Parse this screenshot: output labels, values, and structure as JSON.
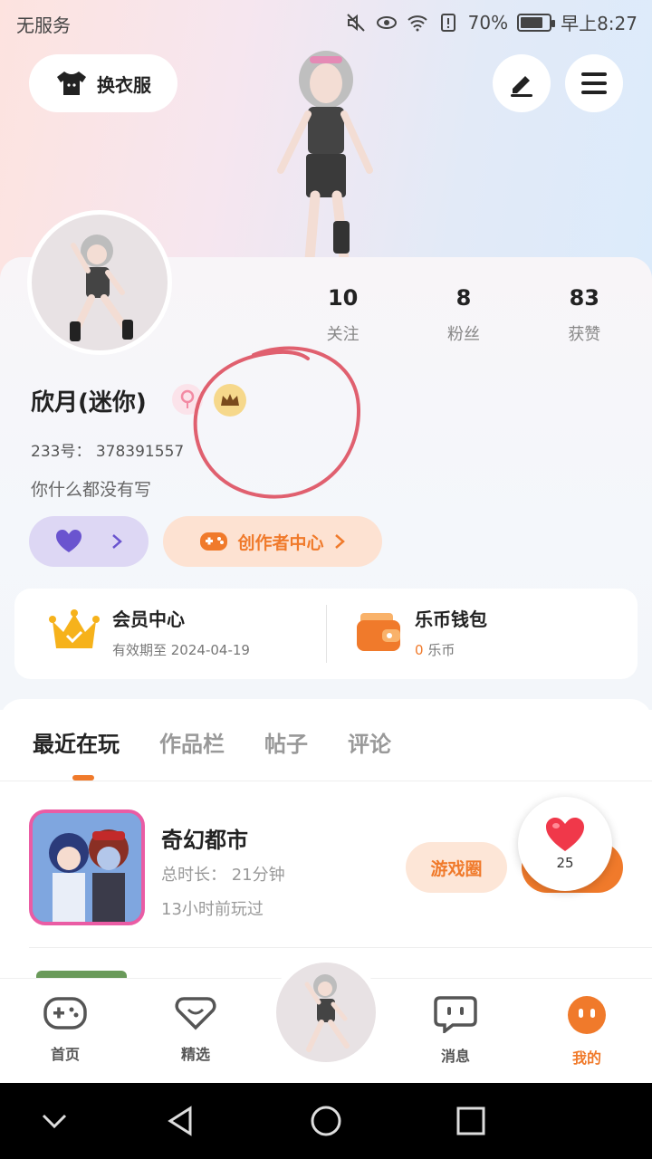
{
  "status_bar": {
    "carrier": "无服务",
    "battery": "70%",
    "time": "早上8:27"
  },
  "header": {
    "outfit_label": "换衣服"
  },
  "profile": {
    "username": "欣月(迷你)",
    "uid": "233号： 378391557",
    "bio": "你什么都没有写",
    "stats": [
      {
        "value": "10",
        "label": "关注"
      },
      {
        "value": "8",
        "label": "粉丝"
      },
      {
        "value": "83",
        "label": "获赞"
      }
    ],
    "creator_label": "创作者中心"
  },
  "member": {
    "vip_title": "会员中心",
    "vip_sub": "有效期至 2024-04-19",
    "wallet_title": "乐币钱包",
    "wallet_amount": "0",
    "wallet_unit": "乐币"
  },
  "tabs": [
    {
      "label": "最近在玩",
      "active": true
    },
    {
      "label": "作品栏",
      "active": false
    },
    {
      "label": "帖子",
      "active": false
    },
    {
      "label": "评论",
      "active": false
    }
  ],
  "game": {
    "name": "奇幻都市",
    "total_time": "总时长： 21分钟",
    "last_played": "13小时前玩过",
    "circle_label": "游戏圈",
    "like_count": "25"
  },
  "bottom_nav": [
    {
      "label": "首页"
    },
    {
      "label": "精选"
    },
    {
      "label": "消息"
    },
    {
      "label": "我的"
    }
  ],
  "colors": {
    "accent": "#f07a2b",
    "annotation": "#e0606f"
  }
}
